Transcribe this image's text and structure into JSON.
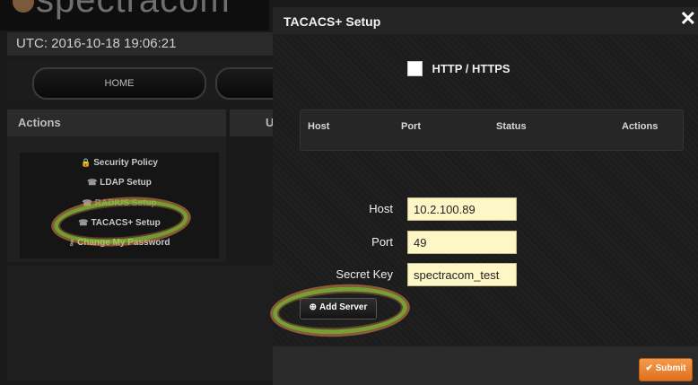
{
  "background": {
    "brand_text": "spectracom",
    "utc_text": "UTC: 2016-10-18 19:06:21",
    "nav": {
      "home_label": "HOME",
      "other_label": ""
    },
    "actions": {
      "title": "Actions",
      "side_col_label": "U",
      "items": [
        {
          "icon": "lock-icon",
          "glyph": "🔒",
          "label": "Security Policy"
        },
        {
          "icon": "phone-icon",
          "glyph": "☎",
          "label": "LDAP Setup"
        },
        {
          "icon": "phone-icon",
          "glyph": "☎",
          "label": "RADIUS Setup"
        },
        {
          "icon": "phone-icon",
          "glyph": "☎",
          "label": "TACACS+ Setup"
        },
        {
          "icon": "key-icon",
          "glyph": "⚷",
          "label": "Change My Password"
        }
      ]
    }
  },
  "modal": {
    "title": "TACACS+ Setup",
    "close_glyph": "✕",
    "http_label": "HTTP / HTTPS",
    "table_headers": [
      "Host",
      "Port",
      "Status",
      "Actions"
    ],
    "form": {
      "host_label": "Host",
      "host_value": "10.2.100.89",
      "port_label": "Port",
      "port_value": "49",
      "secret_label": "Secret Key",
      "secret_value": "spectracom_test"
    },
    "add_server_label": "Add Server",
    "submit_label": "Submit"
  },
  "colors": {
    "accent_orange": "#e8801f",
    "input_bg": "#fdf7c7",
    "highlight_green": "#96c83c",
    "highlight_orange": "#e68c50"
  }
}
